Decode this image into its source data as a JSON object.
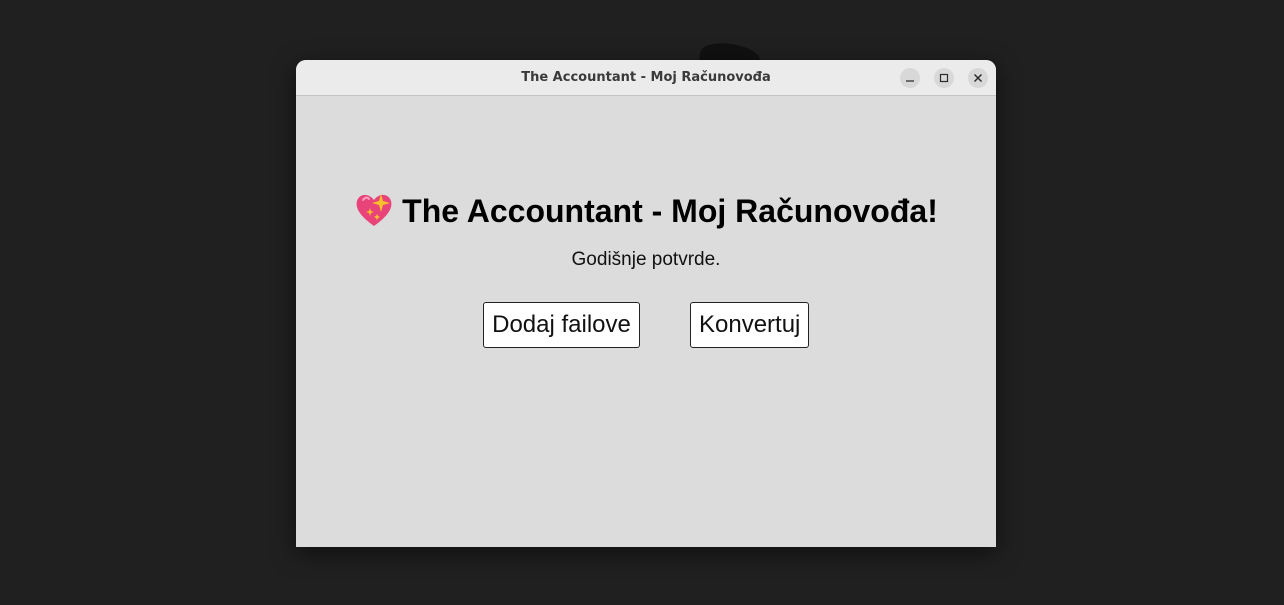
{
  "window": {
    "title": "The Accountant - Moj Računovođa",
    "controls": {
      "minimize_icon": "minimize-icon",
      "maximize_icon": "maximize-icon",
      "close_icon": "close-icon"
    }
  },
  "main": {
    "heading": "The Accountant - Moj Računovođa!",
    "heading_icon": "sparkling-heart-icon",
    "subtitle": "Godišnje potvrde.",
    "buttons": {
      "add_files": "Dodaj failove",
      "convert": "Konvertuj"
    }
  },
  "colors": {
    "desktop_bg": "#202020",
    "window_bg": "#dcdcdc",
    "titlebar_bg": "#ebebeb",
    "heart": "#e8447a",
    "sparkle": "#f7c12c"
  }
}
